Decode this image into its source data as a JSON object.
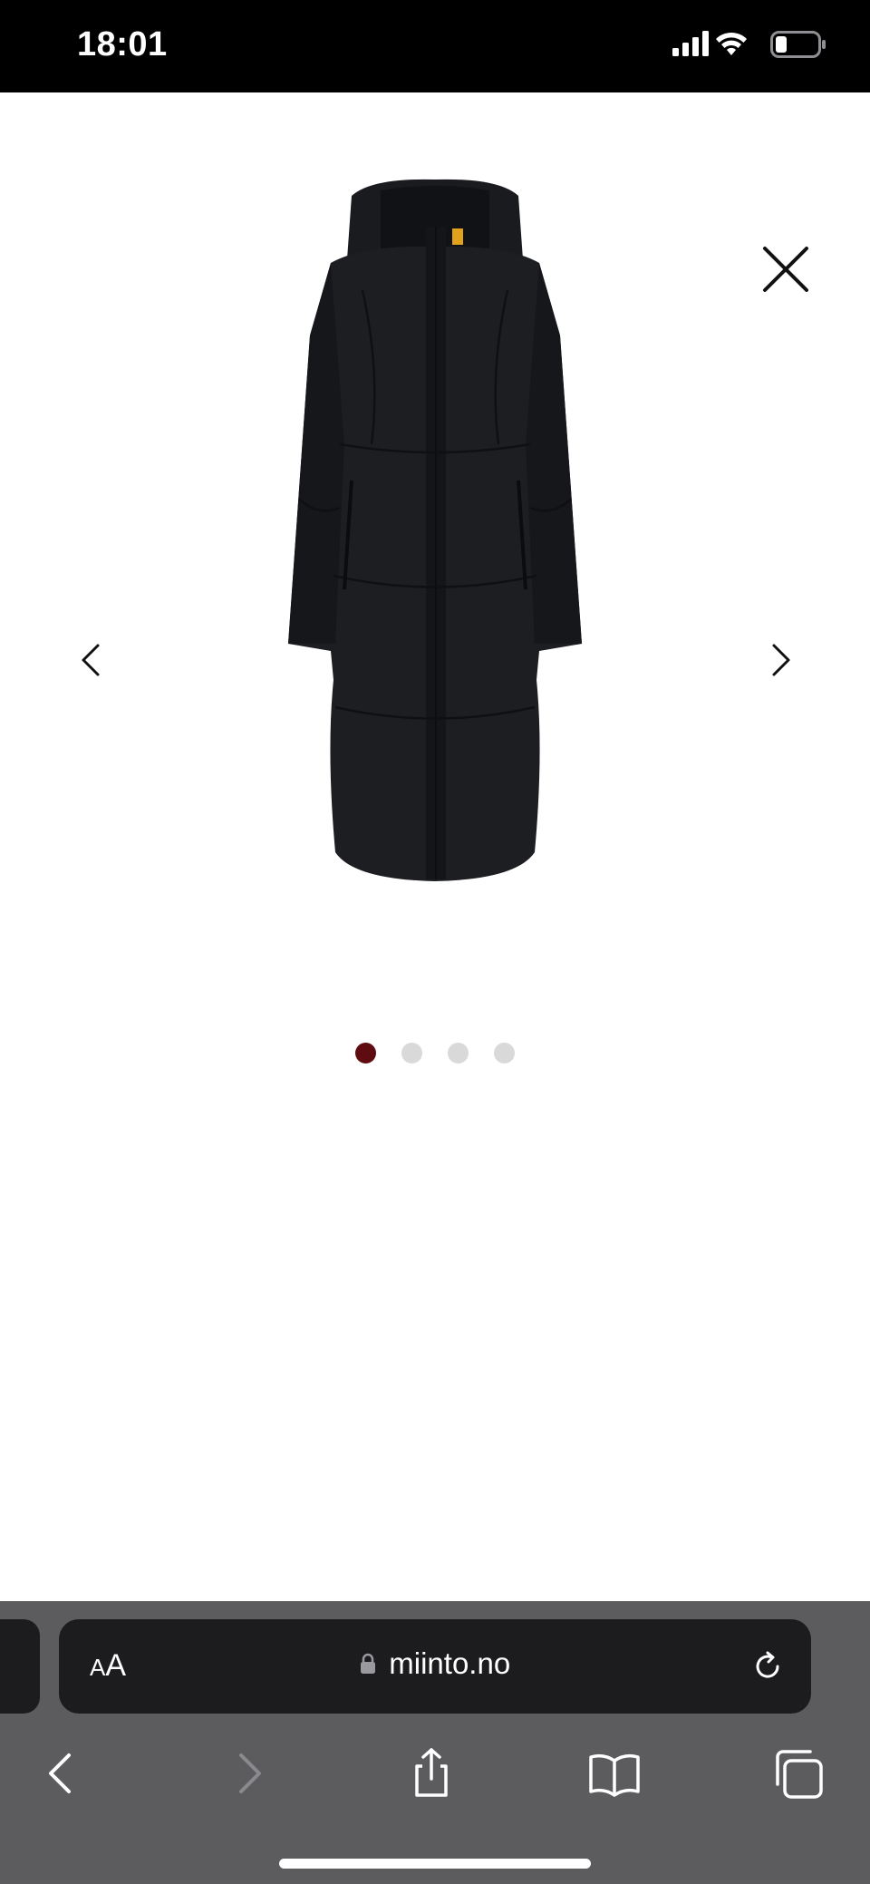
{
  "status_bar": {
    "time": "18:01",
    "icons": [
      "signal-icon",
      "wifi-icon",
      "battery-icon"
    ]
  },
  "gallery": {
    "image_alt": "Black long hooded down coat",
    "icons": {
      "close": "close-icon",
      "prev": "chevron-left-icon",
      "next": "chevron-right-icon"
    },
    "dots": [
      {
        "active": true
      },
      {
        "active": false
      },
      {
        "active": false
      },
      {
        "active": false
      }
    ],
    "active_dot_color": "#5e0c0f",
    "inactive_dot_color": "#d9d9d9"
  },
  "browser": {
    "text_size_label": "AA",
    "url": "miinto.no",
    "icons": {
      "lock": "lock-icon",
      "reload": "reload-icon",
      "back": "back-icon",
      "forward": "forward-icon",
      "share": "share-icon",
      "bookmarks": "bookmarks-icon",
      "tabs": "tabs-icon"
    },
    "forward_enabled": false
  }
}
